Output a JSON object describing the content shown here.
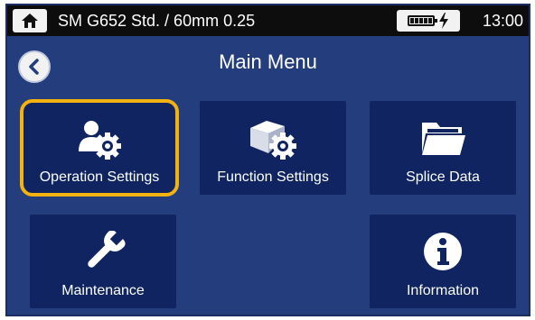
{
  "status_bar": {
    "title": "SM G652 Std. / 60mm 0.25",
    "time": "13:00",
    "home_icon": "home-icon",
    "battery_icon": "battery-charging-icon"
  },
  "header": {
    "title": "Main Menu",
    "back_icon": "chevron-left-icon"
  },
  "menu": [
    {
      "label": "Operation Settings",
      "icon": "user-gear-icon",
      "selected": true
    },
    {
      "label": "Function Settings",
      "icon": "box-gear-icon",
      "selected": false
    },
    {
      "label": "Splice Data",
      "icon": "folder-icon",
      "selected": false
    },
    {
      "label": "Maintenance",
      "icon": "wrench-icon",
      "selected": false
    },
    {
      "label": "Information",
      "icon": "info-icon",
      "selected": false
    }
  ],
  "colors": {
    "background": "#243d7d",
    "tile": "#0f2460",
    "selection": "#f3b20f",
    "status_bar": "#0d0d0d"
  }
}
